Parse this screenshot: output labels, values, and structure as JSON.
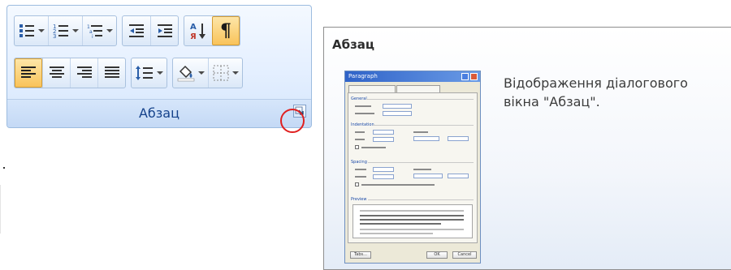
{
  "ribbon": {
    "group_label": "Абзац",
    "row1_icons": [
      "bullets-icon",
      "numbering-icon",
      "multilevel-list-icon",
      "decrease-indent-icon",
      "increase-indent-icon",
      "sort-icon",
      "show-formatting-marks-icon"
    ],
    "row2_icons": [
      "align-left-icon",
      "align-center-icon",
      "align-right-icon",
      "justify-icon",
      "line-spacing-icon",
      "shading-icon",
      "borders-icon"
    ],
    "active_buttons": [
      "show-formatting-marks",
      "align-left"
    ],
    "sort_glyph_top": "А",
    "sort_glyph_bottom": "Я",
    "pilcrow": "¶",
    "highlight_color": "#e02020"
  },
  "tooltip": {
    "title": "Абзац",
    "description": "Відображення діалогового вікна \"Абзац\".",
    "thumbnail": {
      "title": "Paragraph",
      "tabs": [
        "Indents and Spacing",
        "Line and Page Breaks"
      ],
      "sections": [
        "General",
        "Indentation",
        "Spacing",
        "Preview"
      ],
      "buttons": [
        "Tabs...",
        "OK",
        "Cancel"
      ]
    }
  }
}
